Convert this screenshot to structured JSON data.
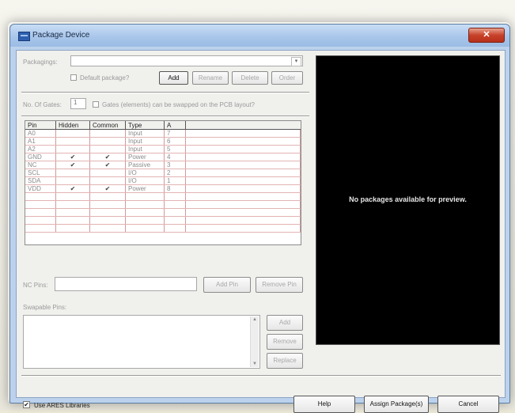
{
  "window": {
    "title": "Package Device",
    "close_glyph": "✕"
  },
  "packagings": {
    "label": "Packagings:",
    "value": "",
    "default_package_label": "Default package?",
    "buttons": {
      "add": "Add",
      "rename": "Rename",
      "delete": "Delete",
      "order": "Order"
    }
  },
  "gates": {
    "label": "No. Of Gates:",
    "value": "1",
    "swap_label": "Gates (elements) can be swapped on the PCB layout?"
  },
  "pin_table": {
    "columns": [
      "Pin",
      "Hidden",
      "Common",
      "Type",
      "A"
    ],
    "rows": [
      [
        "A0",
        "",
        "",
        "Input",
        "7"
      ],
      [
        "A1",
        "",
        "",
        "Input",
        "6"
      ],
      [
        "A2",
        "",
        "",
        "Input",
        "5"
      ],
      [
        "GND",
        "✔",
        "✔",
        "Power",
        "4"
      ],
      [
        "NC",
        "✔",
        "✔",
        "Passive",
        "3"
      ],
      [
        "SCL",
        "",
        "",
        "I/O",
        "2"
      ],
      [
        "SDA",
        "",
        "",
        "I/O",
        "1"
      ],
      [
        "VDD",
        "✔",
        "✔",
        "Power",
        "8"
      ],
      [
        "",
        "",
        "",
        "",
        ""
      ],
      [
        "",
        "",
        "",
        "",
        ""
      ],
      [
        "",
        "",
        "",
        "",
        ""
      ],
      [
        "",
        "",
        "",
        "",
        ""
      ],
      [
        "",
        "",
        "",
        "",
        ""
      ]
    ]
  },
  "nc_pins": {
    "label": "NC Pins:",
    "value": "",
    "add_pin": "Add Pin",
    "remove_pin": "Remove Pin"
  },
  "swapable": {
    "label": "Swapable Pins:",
    "buttons": {
      "add": "Add",
      "remove": "Remove",
      "replace": "Replace"
    }
  },
  "preview": {
    "message": "No packages available for preview."
  },
  "footer": {
    "use_ares_label": "Use ARES Libraries",
    "use_ares_checked": true,
    "help": "Help",
    "assign": "Assign Package(s)",
    "cancel": "Cancel"
  }
}
